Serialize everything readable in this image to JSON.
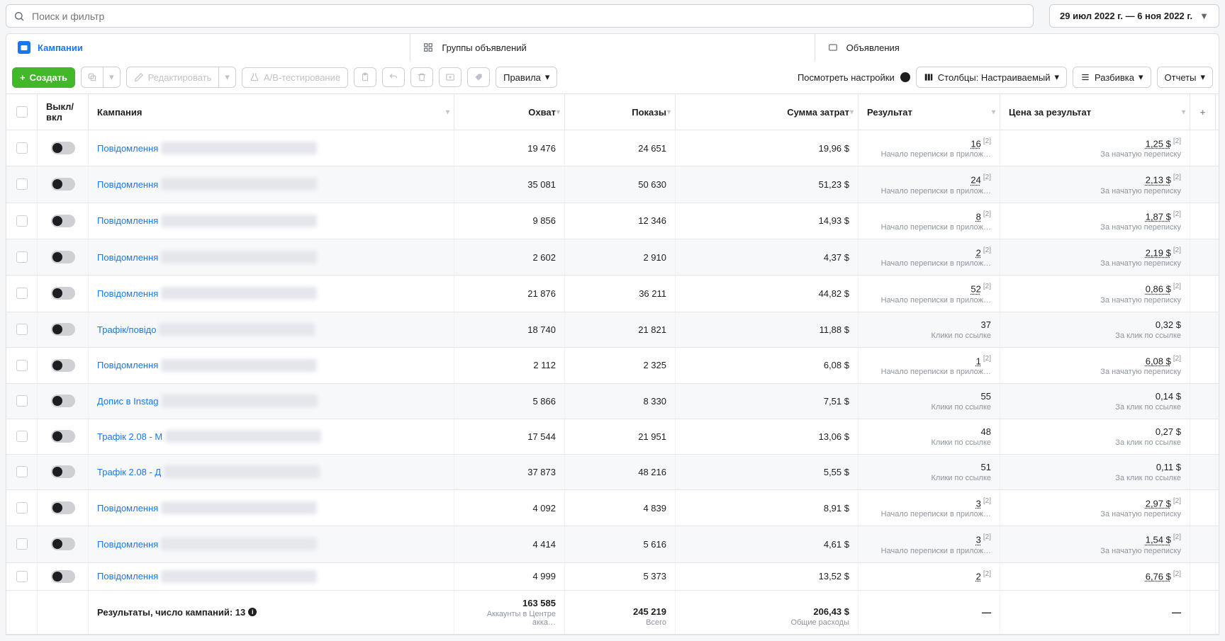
{
  "search": {
    "placeholder": "Поиск и фильтр"
  },
  "date_range": "29 июл 2022 г. — 6 ноя 2022 г.",
  "tabs": {
    "campaigns": "Кампании",
    "adsets": "Группы объявлений",
    "ads": "Объявления"
  },
  "toolbar": {
    "create": "Создать",
    "edit": "Редактировать",
    "ab_test": "A/B-тестирование",
    "rules": "Правила",
    "view_settings": "Посмотреть настройки",
    "columns": "Столбцы: Настраиваемый",
    "breakdown": "Разбивка",
    "reports": "Отчеты"
  },
  "headers": {
    "toggle": "Выкл/вкл",
    "campaign": "Кампания",
    "reach": "Охват",
    "impressions": "Показы",
    "spend": "Сумма затрат",
    "result": "Результат",
    "cost_per_result": "Цена за результат"
  },
  "sub_labels": {
    "msg_start": "Начало переписки в прилож…",
    "link_clicks": "Клики по ссылке",
    "per_msg": "За начатую переписку",
    "per_click": "За клик по ссылке",
    "accounts": "Аккаунты в Центре акка…",
    "total": "Всего",
    "total_spend": "Общие расходы"
  },
  "sup_mark": "[2]",
  "rows": [
    {
      "name": "Повідомлення",
      "reach": "19 476",
      "impr": "24 651",
      "spend": "19,96 $",
      "result": "16",
      "result_sup": true,
      "result_sub": "msg_start",
      "cpr": "1,25 $",
      "cpr_sup": true,
      "cpr_sub": "per_msg",
      "cpr_link": true
    },
    {
      "name": "Повідомлення",
      "reach": "35 081",
      "impr": "50 630",
      "spend": "51,23 $",
      "result": "24",
      "result_sup": true,
      "result_sub": "msg_start",
      "cpr": "2,13 $",
      "cpr_sup": true,
      "cpr_sub": "per_msg",
      "cpr_link": true
    },
    {
      "name": "Повідомлення",
      "reach": "9 856",
      "impr": "12 346",
      "spend": "14,93 $",
      "result": "8",
      "result_sup": true,
      "result_sub": "msg_start",
      "cpr": "1,87 $",
      "cpr_sup": true,
      "cpr_sub": "per_msg",
      "cpr_link": true
    },
    {
      "name": "Повідомлення",
      "reach": "2 602",
      "impr": "2 910",
      "spend": "4,37 $",
      "result": "2",
      "result_sup": true,
      "result_sub": "msg_start",
      "cpr": "2,19 $",
      "cpr_sup": true,
      "cpr_sub": "per_msg",
      "cpr_link": true
    },
    {
      "name": "Повідомлення",
      "reach": "21 876",
      "impr": "36 211",
      "spend": "44,82 $",
      "result": "52",
      "result_sup": true,
      "result_sub": "msg_start",
      "cpr": "0,86 $",
      "cpr_sup": true,
      "cpr_sub": "per_msg",
      "cpr_link": true
    },
    {
      "name": "Трафік/повідо",
      "reach": "18 740",
      "impr": "21 821",
      "spend": "11,88 $",
      "result": "37",
      "result_sup": false,
      "result_sub": "link_clicks",
      "cpr": "0,32 $",
      "cpr_sup": false,
      "cpr_sub": "per_click",
      "cpr_link": false
    },
    {
      "name": "Повідомлення",
      "reach": "2 112",
      "impr": "2 325",
      "spend": "6,08 $",
      "result": "1",
      "result_sup": true,
      "result_sub": "msg_start",
      "cpr": "6,08 $",
      "cpr_sup": true,
      "cpr_sub": "per_msg",
      "cpr_link": true
    },
    {
      "name": "Допис в Instag",
      "reach": "5 866",
      "impr": "8 330",
      "spend": "7,51 $",
      "result": "55",
      "result_sup": false,
      "result_sub": "link_clicks",
      "cpr": "0,14 $",
      "cpr_sup": false,
      "cpr_sub": "per_click",
      "cpr_link": false
    },
    {
      "name": "Трафік 2.08 - М",
      "reach": "17 544",
      "impr": "21 951",
      "spend": "13,06 $",
      "result": "48",
      "result_sup": false,
      "result_sub": "link_clicks",
      "cpr": "0,27 $",
      "cpr_sup": false,
      "cpr_sub": "per_click",
      "cpr_link": false
    },
    {
      "name": "Трафік 2.08 - Д",
      "reach": "37 873",
      "impr": "48 216",
      "spend": "5,55 $",
      "result": "51",
      "result_sup": false,
      "result_sub": "link_clicks",
      "cpr": "0,11 $",
      "cpr_sup": false,
      "cpr_sub": "per_click",
      "cpr_link": false
    },
    {
      "name": "Повідомлення",
      "reach": "4 092",
      "impr": "4 839",
      "spend": "8,91 $",
      "result": "3",
      "result_sup": true,
      "result_sub": "msg_start",
      "cpr": "2,97 $",
      "cpr_sup": true,
      "cpr_sub": "per_msg",
      "cpr_link": true
    },
    {
      "name": "Повідомлення",
      "reach": "4 414",
      "impr": "5 616",
      "spend": "4,61 $",
      "result": "3",
      "result_sup": true,
      "result_sub": "msg_start",
      "cpr": "1,54 $",
      "cpr_sup": true,
      "cpr_sub": "per_msg",
      "cpr_link": true
    },
    {
      "name": "Повідомлення",
      "reach": "4 999",
      "impr": "5 373",
      "spend": "13,52 $",
      "result": "2",
      "result_sup": true,
      "result_sub": "",
      "cpr": "6,76 $",
      "cpr_sup": true,
      "cpr_sub": "",
      "cpr_link": true
    }
  ],
  "footer": {
    "label": "Результаты, число кампаний: 13",
    "reach": "163 585",
    "impr": "245 219",
    "spend": "206,43 $",
    "result": "—",
    "cpr": "—"
  }
}
